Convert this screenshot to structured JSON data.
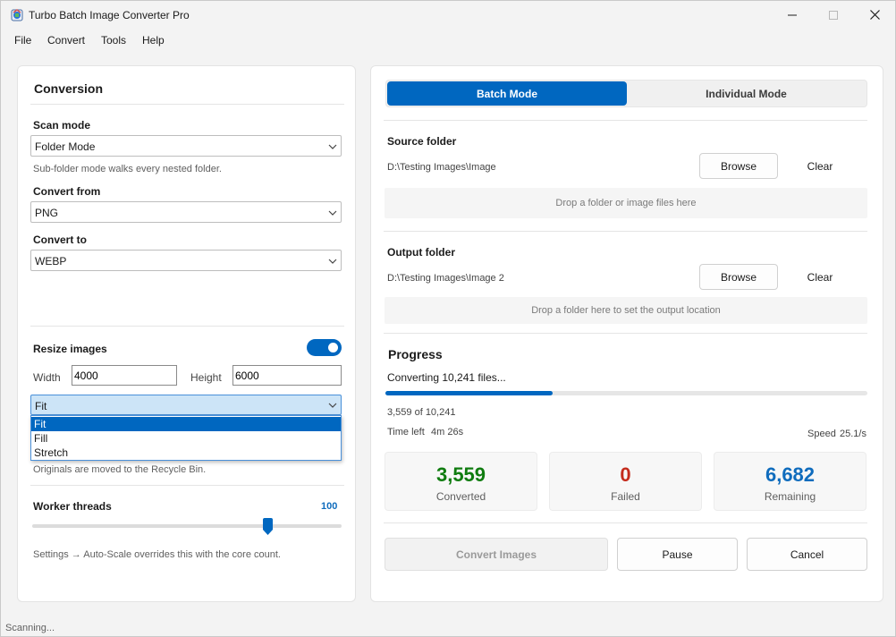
{
  "window": {
    "title": "Turbo Batch Image Converter Pro"
  },
  "menu": [
    "File",
    "Convert",
    "Tools",
    "Help"
  ],
  "conversion": {
    "header": "Conversion",
    "scan_mode": {
      "label": "Scan mode",
      "value": "Folder Mode",
      "hint": "Sub-folder mode walks every nested folder."
    },
    "convert_from": {
      "label": "Convert from",
      "value": "PNG"
    },
    "convert_to": {
      "label": "Convert to",
      "value": "WEBP"
    },
    "resize": {
      "label": "Resize images",
      "enabled": true,
      "width_label": "Width",
      "width_value": "4000",
      "height_label": "Height",
      "height_value": "6000",
      "mode_value": "Fit",
      "mode_options": [
        "Fit",
        "Fill",
        "Stretch"
      ],
      "mode_selected": "Fit"
    },
    "recycle_hint": "Originals are moved to the Recycle Bin.",
    "threads": {
      "label": "Worker threads",
      "value": "100",
      "level_fraction": 0.76,
      "hint": "Settings → Auto-Scale overrides this with the core count."
    }
  },
  "modes": {
    "batch": "Batch Mode",
    "individual": "Individual Mode",
    "active": "batch"
  },
  "source": {
    "label": "Source folder",
    "path": "D:\\Testing Images\\Image",
    "browse": "Browse",
    "clear": "Clear",
    "drop_hint": "Drop a folder or image files here"
  },
  "output": {
    "label": "Output folder",
    "path": "D:\\Testing Images\\Image 2",
    "browse": "Browse",
    "clear": "Clear",
    "drop_hint": "Drop a folder here to set the output location"
  },
  "progress": {
    "header": "Progress",
    "status": "Converting 10,241 files...",
    "fraction": 0.347,
    "count": "3,559 of 10,241",
    "time_left_label": "Time left",
    "time_left_value": "4m 26s",
    "speed_label": "Speed",
    "speed_value": "25.1/s"
  },
  "stats": [
    {
      "value": "3,559",
      "caption": "Converted",
      "color": "#107c10"
    },
    {
      "value": "0",
      "caption": "Failed",
      "color": "#c42b1c"
    },
    {
      "value": "6,682",
      "caption": "Remaining",
      "color": "#0f6cbd"
    }
  ],
  "actions": {
    "convert": "Convert Images",
    "pause": "Pause",
    "cancel": "Cancel"
  },
  "statusbar": {
    "text": "Scanning..."
  },
  "colors": {
    "accent": "#0067c0"
  }
}
